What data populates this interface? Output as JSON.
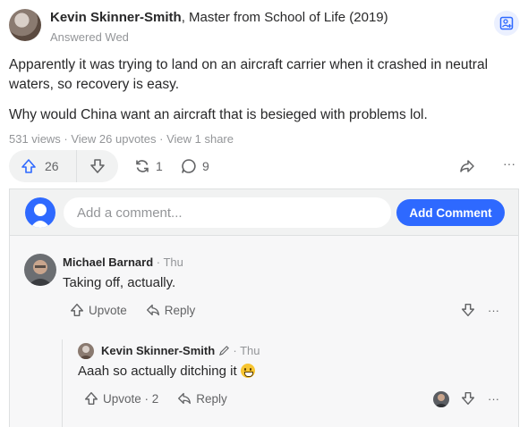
{
  "answer": {
    "author_name": "Kevin Skinner-Smith",
    "author_credential": ", Master from School of Life (2019)",
    "answered_time": "Answered Wed",
    "paragraphs": [
      "Apparently it was trying to land on an aircraft carrier when it crashed in neutral waters, so recovery is easy.",
      "Why would China want an aircraft that is besieged with problems lol."
    ],
    "stats": "531 views · View 26 upvotes · View 1 share",
    "upvotes": "26",
    "shares": "1",
    "comments": "9",
    "more": "···"
  },
  "add_comment": {
    "placeholder": "Add a comment...",
    "button_label": "Add Comment"
  },
  "comments": [
    {
      "author": "Michael Barnard",
      "time": " · Thu",
      "text": "Taking off, actually.",
      "upvote_label": "Upvote",
      "reply_label": "Reply",
      "more": "···"
    },
    {
      "author": "Kevin Skinner-Smith",
      "time": " · Thu",
      "text": "Aaah so actually ditching it",
      "upvote_label": "Upvote · 2",
      "reply_label": "Reply",
      "more": "···"
    }
  ],
  "colors": {
    "accent": "#2e69ff",
    "muted": "#939598",
    "text": "#282829"
  }
}
